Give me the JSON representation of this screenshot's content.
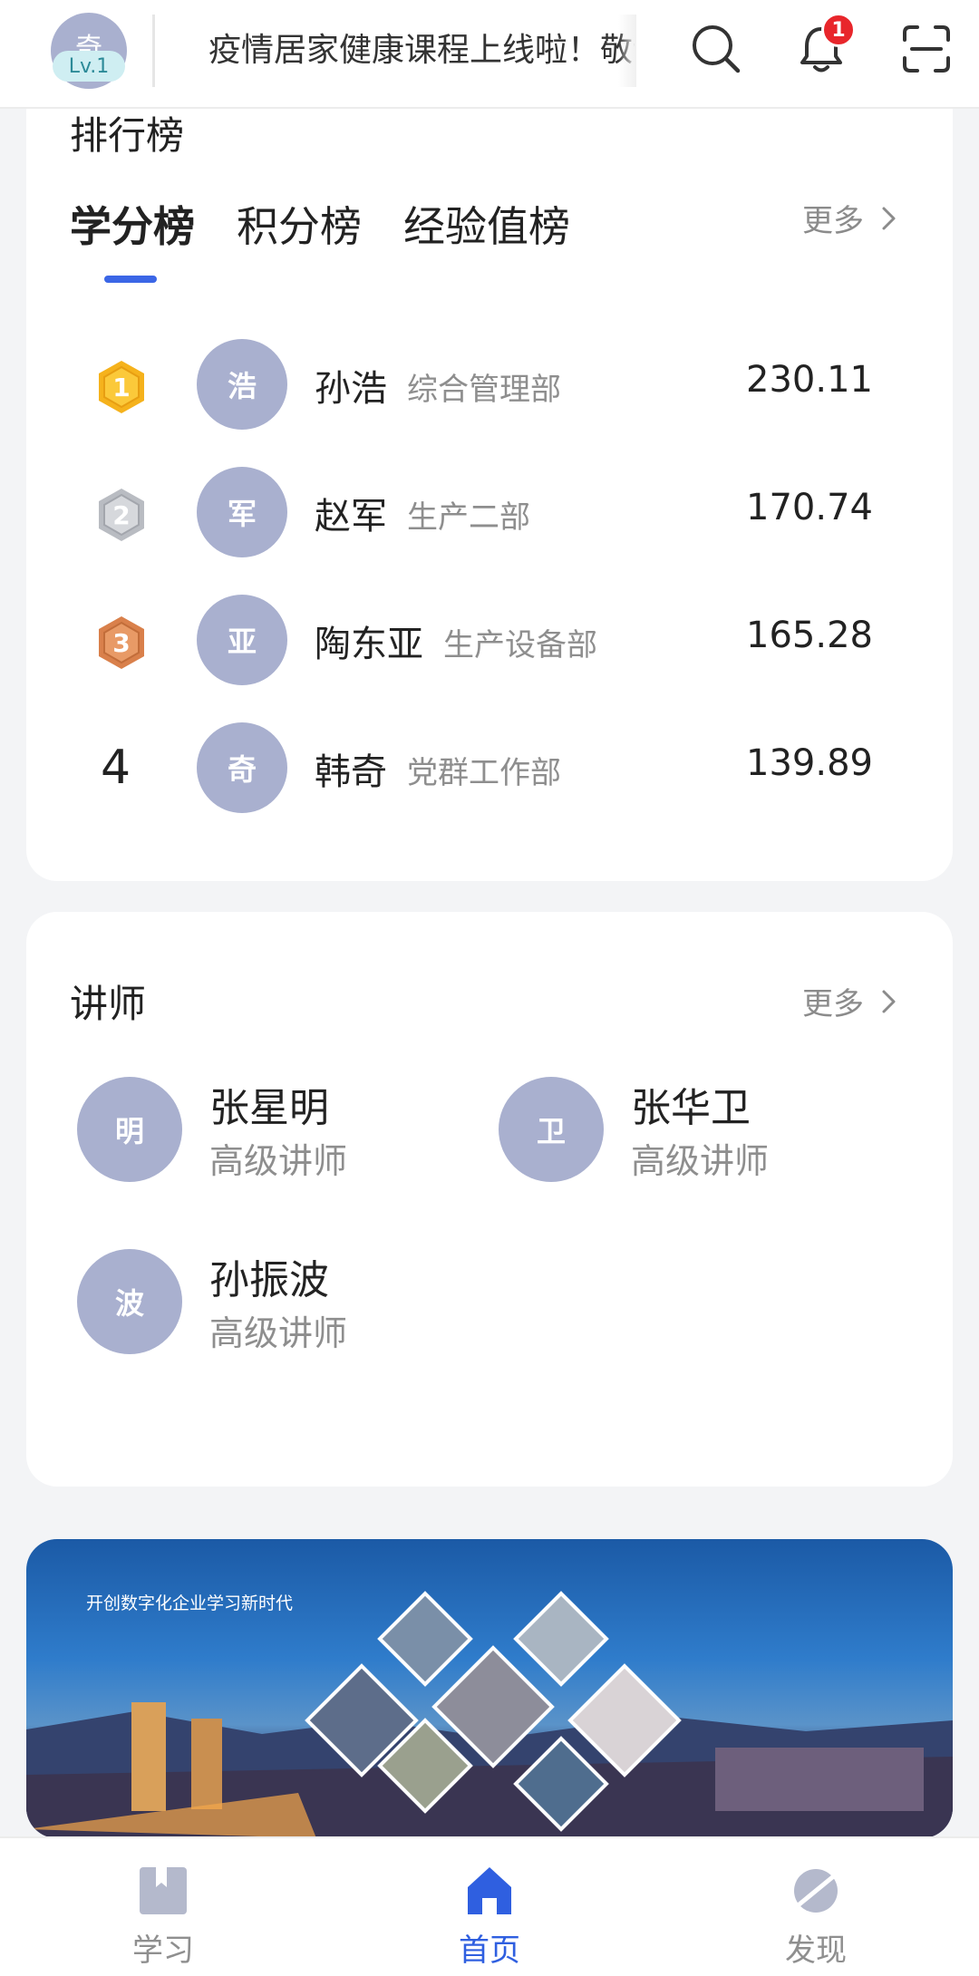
{
  "header": {
    "avatar_char": "奇",
    "level": "Lv.1",
    "marquee": "疫情居家健康课程上线啦！敬请",
    "notification_count": "1",
    "icons": [
      "search-icon",
      "bell-icon",
      "scan-icon"
    ]
  },
  "ranking": {
    "title": "排行榜",
    "tabs": [
      {
        "label": "学分榜",
        "active": true
      },
      {
        "label": "积分榜",
        "active": false
      },
      {
        "label": "经验值榜",
        "active": false
      }
    ],
    "more_label": "更多",
    "rows": [
      {
        "rank": "1",
        "avatar": "浩",
        "name": "孙浩",
        "dept": "综合管理部",
        "score": "230.11",
        "medal": "gold"
      },
      {
        "rank": "2",
        "avatar": "军",
        "name": "赵军",
        "dept": "生产二部",
        "score": "170.74",
        "medal": "silver"
      },
      {
        "rank": "3",
        "avatar": "亚",
        "name": "陶东亚",
        "dept": "生产设备部",
        "score": "165.28",
        "medal": "bronze"
      },
      {
        "rank": "4",
        "avatar": "奇",
        "name": "韩奇",
        "dept": "党群工作部",
        "score": "139.89",
        "medal": "none"
      }
    ]
  },
  "lecturers": {
    "title": "讲师",
    "more_label": "更多",
    "items": [
      {
        "avatar": "明",
        "name": "张星明",
        "title": "高级讲师"
      },
      {
        "avatar": "卫",
        "name": "张华卫",
        "title": "高级讲师"
      },
      {
        "avatar": "波",
        "name": "孙振波",
        "title": "高级讲师"
      }
    ]
  },
  "banner": {
    "text": "开创数字化企业学习新时代"
  },
  "bottom_nav": [
    {
      "label": "学习",
      "icon": "book-icon",
      "active": false
    },
    {
      "label": "首页",
      "icon": "home-icon",
      "active": true
    },
    {
      "label": "发现",
      "icon": "planet-icon",
      "active": false
    }
  ],
  "colors": {
    "accent": "#3b66e6",
    "avatar_bg": "#a9b0cf",
    "badge_red": "#e8262b",
    "gold": "#f5b21c",
    "silver": "#b9bcc2",
    "bronze": "#d9804b"
  }
}
